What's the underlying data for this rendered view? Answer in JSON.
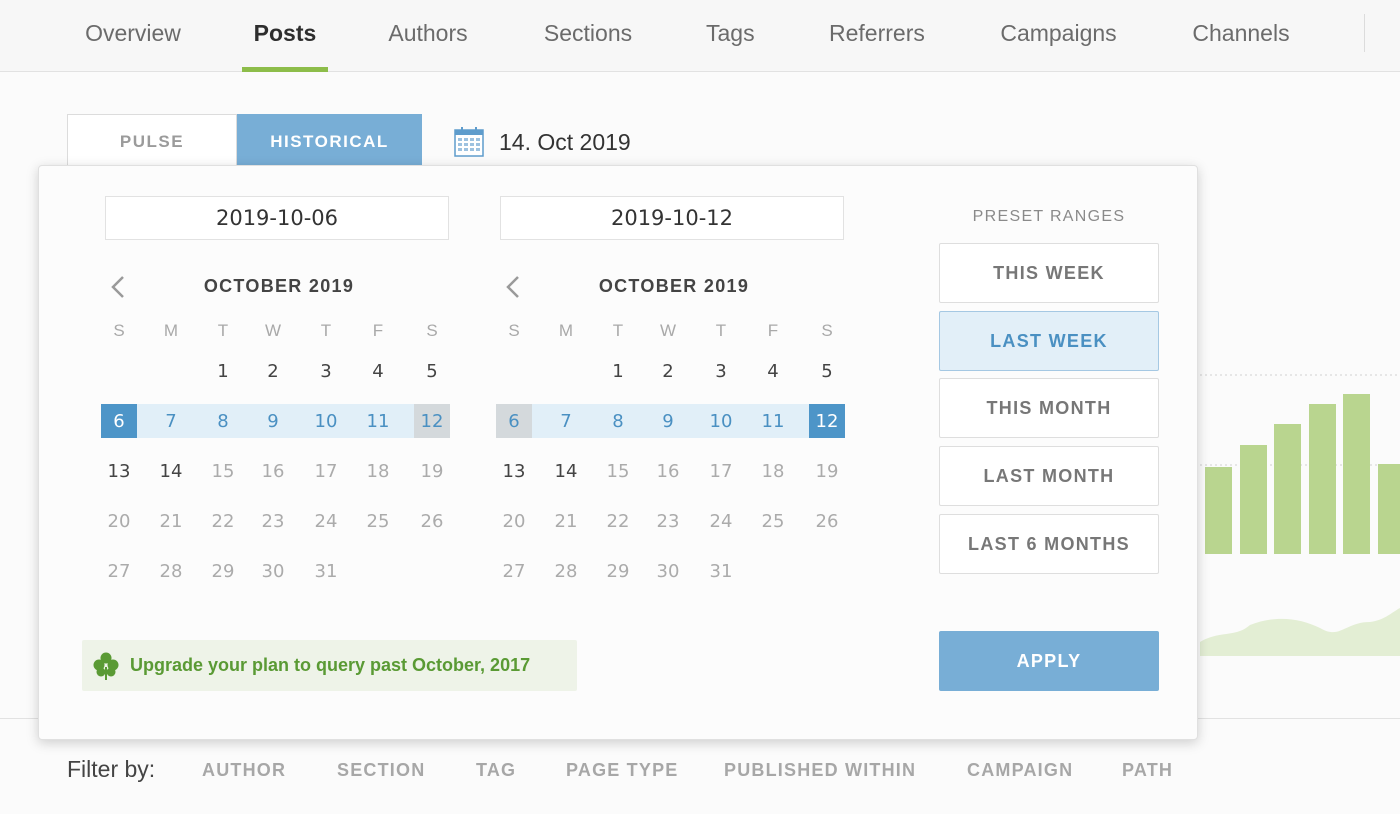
{
  "nav": {
    "tabs": [
      {
        "label": "Overview",
        "active": false
      },
      {
        "label": "Posts",
        "active": true
      },
      {
        "label": "Authors",
        "active": false
      },
      {
        "label": "Sections",
        "active": false
      },
      {
        "label": "Tags",
        "active": false
      },
      {
        "label": "Referrers",
        "active": false
      },
      {
        "label": "Campaigns",
        "active": false
      },
      {
        "label": "Channels",
        "active": false
      }
    ]
  },
  "mode": {
    "pulse_label": "PULSE",
    "historical_label": "HISTORICAL",
    "active": "historical"
  },
  "current_date": "14. Oct 2019",
  "picker": {
    "start_value": "2019-10-06",
    "end_value": "2019-10-12",
    "weekday_labels": [
      "S",
      "M",
      "T",
      "W",
      "T",
      "F",
      "S"
    ],
    "left_calendar": {
      "title": "OCTOBER 2019"
    },
    "right_calendar": {
      "title": "OCTOBER 2019"
    },
    "month_start_weekday": 2,
    "days_in_month": 31,
    "range_start": 6,
    "range_end": 12,
    "today": 14,
    "preset_title": "PRESET RANGES",
    "presets": [
      {
        "label": "THIS WEEK",
        "active": false
      },
      {
        "label": "LAST WEEK",
        "active": true
      },
      {
        "label": "THIS MONTH",
        "active": false
      },
      {
        "label": "LAST MONTH",
        "active": false
      },
      {
        "label": "LAST 6 MONTHS",
        "active": false
      }
    ],
    "upgrade_text": "Upgrade your plan to query past October, 2017",
    "apply_label": "APPLY"
  },
  "filter": {
    "label": "Filter by:",
    "items": [
      "AUTHOR",
      "SECTION",
      "TAG",
      "PAGE TYPE",
      "PUBLISHED WITHIN",
      "CAMPAIGN",
      "PATH"
    ]
  },
  "colors": {
    "accent_blue": "#78aed6",
    "range_blue": "#4a90c2",
    "active_tab_underline": "#8dbd4a",
    "chart_green": "#b9d58f",
    "upgrade_green": "#5a9a34"
  }
}
